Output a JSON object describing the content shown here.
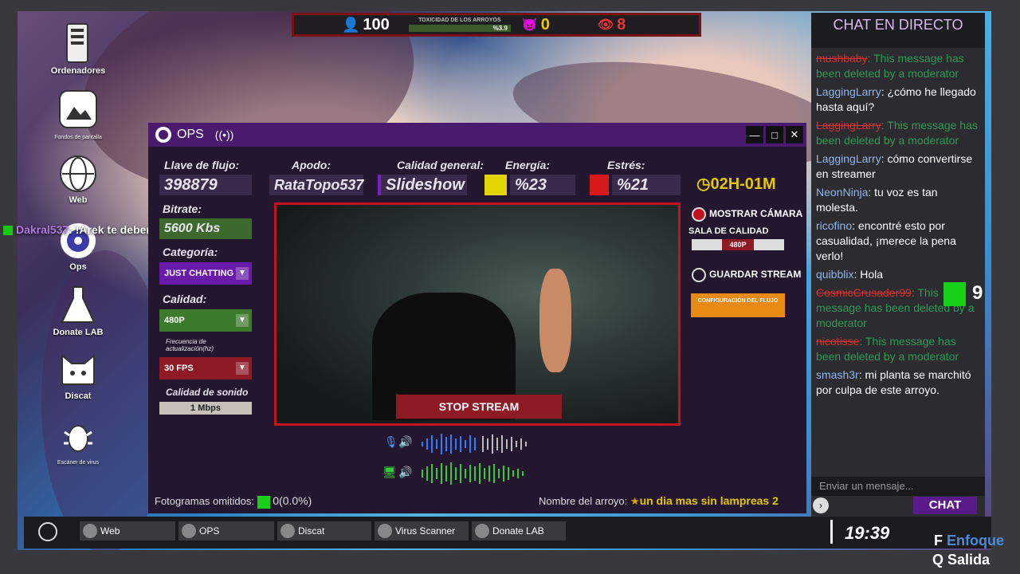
{
  "hud": {
    "viewers": "100",
    "toxicity_label": "TOXICIDAD DE LOS ARROYOS",
    "toxicity_value": "%3.9",
    "toxicity_fraction": 0.039,
    "devil_count": "0",
    "alerts_count": "8"
  },
  "desktop": {
    "icons": [
      {
        "label": "Ordenadores"
      },
      {
        "label": "Fondos de pantalla"
      },
      {
        "label": "Web"
      },
      {
        "label": "Ops"
      },
      {
        "label": "Donate LAB"
      },
      {
        "label": "Discat"
      },
      {
        "label": "Escáner de virus"
      }
    ]
  },
  "overlay_chat": {
    "user": "Dakral537",
    "text": ": !Arek te deberadar vergüenza, consigue un trabajo"
  },
  "ops": {
    "title": "OPS",
    "stream_key_label": "Llave de flujo:",
    "stream_key_value": "398879",
    "nickname_label": "Apodo:",
    "nickname_value": "RataTopo537",
    "quality_general_label": "Calidad general:",
    "quality_general_value": "Slideshow",
    "energy_label": "Energía:",
    "energy_value": "%23",
    "stress_label": "Estrés:",
    "stress_value": "%21",
    "timer": "02H-01M",
    "bitrate_label": "Bitrate:",
    "bitrate_value": "5600 Kbs",
    "category_label": "Categoría:",
    "category_value": "JUST CHATTING",
    "quality_label": "Calidad:",
    "quality_value": "480P",
    "refresh_label": "Frecuencia de actualización(hz)",
    "refresh_value": "30 FPS",
    "sound_label": "Calidad de sonido",
    "sound_value": "1 Mbps",
    "show_camera": "MOSTRAR CÁMARA",
    "quality_room_label": "SALA DE CALIDAD",
    "quality_room_value": "480P",
    "save_stream": "GUARDAR STREAM",
    "config_button": "CONFIGURACIÓN DEL FLUJO",
    "stop_button": "STOP STREAM",
    "dropped_frames_label": "Fotogramas omitidos:",
    "dropped_frames_value": "0(0.0%)",
    "stream_name_label": "Nombre del arroyo:",
    "stream_name_value": "un dia mas sin lampreas 2",
    "colors": {
      "energy": "#e1d400",
      "stress": "#d91a1a",
      "accent": "#4a1a6e"
    }
  },
  "chat": {
    "title": "CHAT EN DIRECTO",
    "messages": [
      {
        "user": "mushbaby",
        "text": ": This message has been deleted by a moderator",
        "deleted": true
      },
      {
        "user": "LaggingLarry",
        "text": ": ¿cómo he llegado hasta aquí?",
        "deleted": false
      },
      {
        "user": "LaggingLarry",
        "text": ": This message has been deleted by a moderator",
        "deleted": true
      },
      {
        "user": "LaggingLarry",
        "text": ": cómo convertirse en streamer",
        "deleted": false
      },
      {
        "user": "NeonNinja",
        "text": ": tu voz es tan molesta.",
        "deleted": false
      },
      {
        "user": "ricofino",
        "text": ": encontré esto por casualidad, ¡merece la pena verlo!",
        "deleted": false
      },
      {
        "user": "quibblix",
        "text": ": Hola",
        "deleted": false
      },
      {
        "user": "CosmicCrusader99",
        "text": ": This message has been deleted by a moderator",
        "deleted": true
      },
      {
        "user": "nicotisse",
        "text": ": This message has been deleted by a moderator",
        "deleted": true
      },
      {
        "user": "smash3r",
        "text": ": mi planta se marchitó por culpa de este arroyo.",
        "deleted": false
      }
    ],
    "input_placeholder": "Enviar un mensaje...",
    "send_button": "CHAT",
    "badge_count": "9"
  },
  "taskbar": {
    "items": [
      "Web",
      "OPS",
      "Discat",
      "Virus Scanner",
      "Donate LAB"
    ],
    "clock": "19:39"
  },
  "hints": {
    "focus_key": "F",
    "focus_label": "Enfoque",
    "exit_key": "Q",
    "exit_label": "Salida"
  }
}
